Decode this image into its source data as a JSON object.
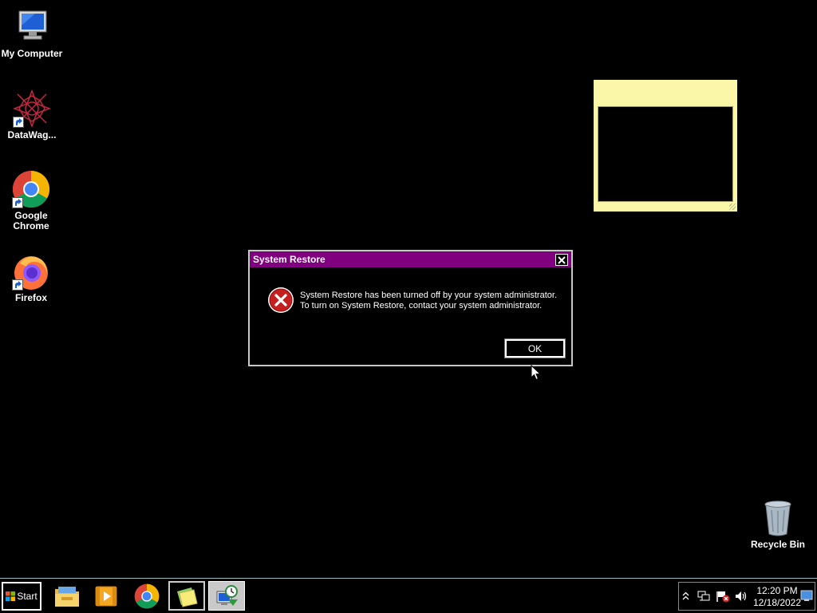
{
  "desktop": {
    "icons": [
      {
        "name": "my-computer",
        "label": "My Computer"
      },
      {
        "name": "datawag",
        "label": "DataWag..."
      },
      {
        "name": "google-chrome",
        "label": "Google Chrome"
      },
      {
        "name": "firefox",
        "label": "Firefox"
      },
      {
        "name": "recycle-bin",
        "label": "Recycle Bin"
      }
    ]
  },
  "dialog": {
    "title": "System Restore",
    "message_line1": "System Restore has been turned off by your system administrator.",
    "message_line2": "To turn on System Restore, contact your system administrator.",
    "ok_label": "OK",
    "icon": "error-icon"
  },
  "taskbar": {
    "start_label": "Start",
    "buttons": [
      "file-explorer-icon",
      "media-player-icon",
      "chrome-icon",
      "sticky-notes-icon",
      "system-restore-icon"
    ],
    "clock": {
      "time": "12:20 PM",
      "date": "12/18/2022"
    },
    "tray": [
      "show-hidden-icons",
      "network-icon",
      "action-center-flag-icon",
      "volume-icon",
      "show-desktop"
    ]
  },
  "colors": {
    "dialog_title": "#800080",
    "sticky_note": "#fbf7a8",
    "background": "#000000"
  }
}
